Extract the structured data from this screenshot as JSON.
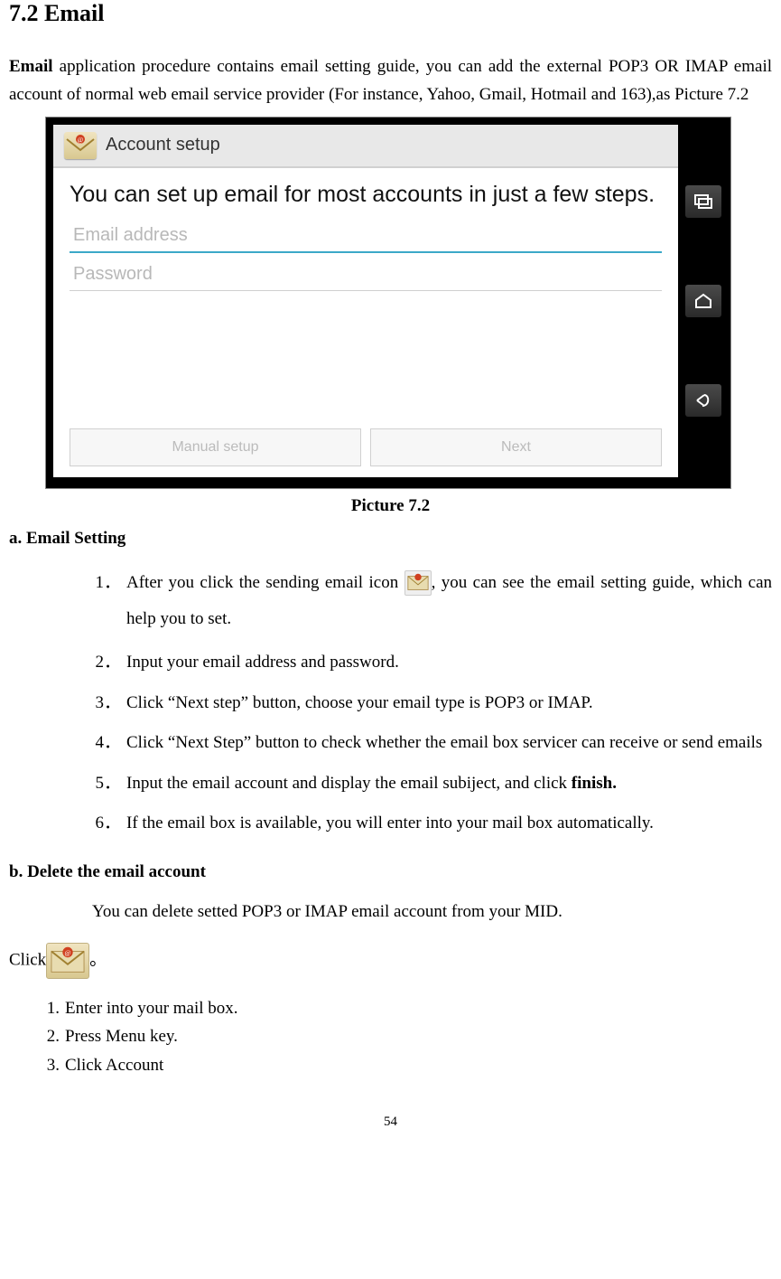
{
  "section": {
    "title": "7.2 Email"
  },
  "intro": {
    "bold_word": "Email",
    "rest": " application procedure contains email setting guide, you can add the external POP3 OR IMAP email account of normal web email service provider (For instance, Yahoo, Gmail, Hotmail and 163),as Picture 7.2"
  },
  "screenshot": {
    "header_title": "Account setup",
    "headline": "You can set up email for most accounts in just a few steps.",
    "email_placeholder": "Email address",
    "password_placeholder": "Password",
    "manual_btn": "Manual setup",
    "next_btn": "Next"
  },
  "caption": "Picture 7.2",
  "section_a": {
    "title": "a. Email Setting",
    "steps": [
      {
        "n": "1．",
        "pre": "After you click the sending email icon ",
        "post": ", you can see the email setting guide, which can help you to set."
      },
      {
        "n": "2．",
        "text": "Input your email address and password."
      },
      {
        "n": "3．",
        "text": "Click “Next step” button, choose your email type is POP3 or IMAP."
      },
      {
        "n": "4．",
        "text": "Click “Next Step” button to check whether the email box servicer can receive or send emails"
      },
      {
        "n": "5．",
        "pre": "Input the email account and display the email subiject, and click ",
        "bold": "finish."
      },
      {
        "n": "6．",
        "text": "If the email box is available, you will enter into your mail box automatically."
      }
    ]
  },
  "section_b": {
    "title": "b. Delete the email account",
    "desc": "You can delete setted POP3 or IMAP email account from your MID.",
    "click_word": "Click",
    "click_punct": "。",
    "steps": [
      {
        "n": "1.",
        "text": "Enter into your mail box."
      },
      {
        "n": "2.",
        "text": "Press Menu key."
      },
      {
        "n": "3.",
        "text": "Click Account"
      }
    ]
  },
  "page_number": "54"
}
